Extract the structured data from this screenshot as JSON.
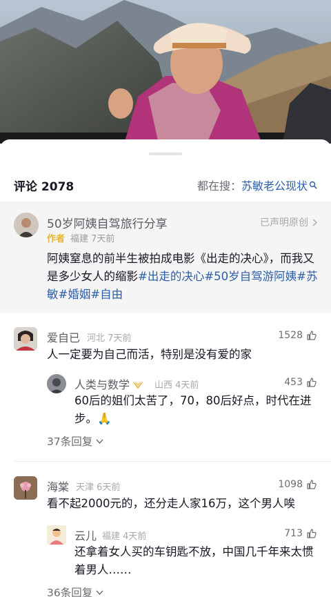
{
  "comments_panel": {
    "title": "评论 2078",
    "search_prefix": "都在搜：",
    "search_term": "苏敏老公现状"
  },
  "author_post": {
    "name": "50岁阿姨自驾旅行分享",
    "declare_label": "已声明原创",
    "tag": "作者",
    "meta": "福建 7天前",
    "text_plain": "阿姨窒息的前半生被拍成电影《出走的决心》，而我又是多少女人的缩影",
    "hashtags": [
      "#出走的决心",
      "#50岁自驾游阿姨",
      "#苏敏",
      "#婚姻",
      "#自由"
    ]
  },
  "comments": [
    {
      "name": "爱自已",
      "region": "河北 7天前",
      "likes": "1528",
      "text": "人一定要为自己而活，特别是没有爱的家",
      "reply": {
        "name": "人类与数学",
        "region": "山西 4天前",
        "likes": "453",
        "text": "60后的姐们太苦了，70，80后好点，时代在进步。🙏"
      },
      "more_replies": "37条回复"
    },
    {
      "name": "海棠",
      "region": "天津 6天前",
      "likes": "1098",
      "text": "看不起2000元的，还分走人家16万，这个男人唉",
      "reply": {
        "name": "云儿",
        "region": "福建 4天前",
        "likes": "713",
        "text": "还拿着女人买的车钥匙不放，中国几千年来太惯着男人……"
      },
      "more_replies": "36条回复"
    }
  ],
  "colors": {
    "link": "#2c5ea8",
    "author_tag": "#e8b52d",
    "secondary_text": "#6b6c72",
    "author_block_bg": "#f5f5f6"
  }
}
